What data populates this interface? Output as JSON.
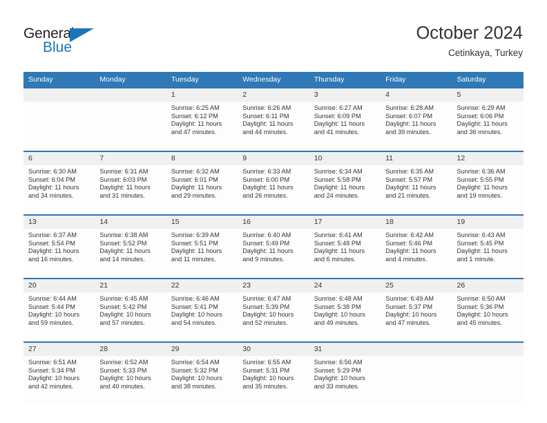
{
  "brand": {
    "name_top": "General",
    "name_bottom": "Blue",
    "triangle_icon": "blue-triangle-icon",
    "color_dark": "#231f20",
    "color_blue": "#1b75bb"
  },
  "header": {
    "title": "October 2024",
    "subtitle": "Cetinkaya, Turkey"
  },
  "theme": {
    "header_blue": "#3078b6",
    "row_divider_blue": "#2e75b6",
    "daynum_band": "#f0f0f0",
    "text": "#333333"
  },
  "calendar": {
    "weekday_headers": [
      "Sunday",
      "Monday",
      "Tuesday",
      "Wednesday",
      "Thursday",
      "Friday",
      "Saturday"
    ],
    "weeks": [
      [
        {
          "day": "",
          "lines": []
        },
        {
          "day": "",
          "lines": []
        },
        {
          "day": "1",
          "lines": [
            "Sunrise: 6:25 AM",
            "Sunset: 6:12 PM",
            "Daylight: 11 hours",
            "and 47 minutes."
          ]
        },
        {
          "day": "2",
          "lines": [
            "Sunrise: 6:26 AM",
            "Sunset: 6:11 PM",
            "Daylight: 11 hours",
            "and 44 minutes."
          ]
        },
        {
          "day": "3",
          "lines": [
            "Sunrise: 6:27 AM",
            "Sunset: 6:09 PM",
            "Daylight: 11 hours",
            "and 41 minutes."
          ]
        },
        {
          "day": "4",
          "lines": [
            "Sunrise: 6:28 AM",
            "Sunset: 6:07 PM",
            "Daylight: 11 hours",
            "and 39 minutes."
          ]
        },
        {
          "day": "5",
          "lines": [
            "Sunrise: 6:29 AM",
            "Sunset: 6:06 PM",
            "Daylight: 11 hours",
            "and 36 minutes."
          ]
        }
      ],
      [
        {
          "day": "6",
          "lines": [
            "Sunrise: 6:30 AM",
            "Sunset: 6:04 PM",
            "Daylight: 11 hours",
            "and 34 minutes."
          ]
        },
        {
          "day": "7",
          "lines": [
            "Sunrise: 6:31 AM",
            "Sunset: 6:03 PM",
            "Daylight: 11 hours",
            "and 31 minutes."
          ]
        },
        {
          "day": "8",
          "lines": [
            "Sunrise: 6:32 AM",
            "Sunset: 6:01 PM",
            "Daylight: 11 hours",
            "and 29 minutes."
          ]
        },
        {
          "day": "9",
          "lines": [
            "Sunrise: 6:33 AM",
            "Sunset: 6:00 PM",
            "Daylight: 11 hours",
            "and 26 minutes."
          ]
        },
        {
          "day": "10",
          "lines": [
            "Sunrise: 6:34 AM",
            "Sunset: 5:58 PM",
            "Daylight: 11 hours",
            "and 24 minutes."
          ]
        },
        {
          "day": "11",
          "lines": [
            "Sunrise: 6:35 AM",
            "Sunset: 5:57 PM",
            "Daylight: 11 hours",
            "and 21 minutes."
          ]
        },
        {
          "day": "12",
          "lines": [
            "Sunrise: 6:36 AM",
            "Sunset: 5:55 PM",
            "Daylight: 11 hours",
            "and 19 minutes."
          ]
        }
      ],
      [
        {
          "day": "13",
          "lines": [
            "Sunrise: 6:37 AM",
            "Sunset: 5:54 PM",
            "Daylight: 11 hours",
            "and 16 minutes."
          ]
        },
        {
          "day": "14",
          "lines": [
            "Sunrise: 6:38 AM",
            "Sunset: 5:52 PM",
            "Daylight: 11 hours",
            "and 14 minutes."
          ]
        },
        {
          "day": "15",
          "lines": [
            "Sunrise: 6:39 AM",
            "Sunset: 5:51 PM",
            "Daylight: 11 hours",
            "and 11 minutes."
          ]
        },
        {
          "day": "16",
          "lines": [
            "Sunrise: 6:40 AM",
            "Sunset: 5:49 PM",
            "Daylight: 11 hours",
            "and 9 minutes."
          ]
        },
        {
          "day": "17",
          "lines": [
            "Sunrise: 6:41 AM",
            "Sunset: 5:48 PM",
            "Daylight: 11 hours",
            "and 6 minutes."
          ]
        },
        {
          "day": "18",
          "lines": [
            "Sunrise: 6:42 AM",
            "Sunset: 5:46 PM",
            "Daylight: 11 hours",
            "and 4 minutes."
          ]
        },
        {
          "day": "19",
          "lines": [
            "Sunrise: 6:43 AM",
            "Sunset: 5:45 PM",
            "Daylight: 11 hours",
            "and 1 minute."
          ]
        }
      ],
      [
        {
          "day": "20",
          "lines": [
            "Sunrise: 6:44 AM",
            "Sunset: 5:44 PM",
            "Daylight: 10 hours",
            "and 59 minutes."
          ]
        },
        {
          "day": "21",
          "lines": [
            "Sunrise: 6:45 AM",
            "Sunset: 5:42 PM",
            "Daylight: 10 hours",
            "and 57 minutes."
          ]
        },
        {
          "day": "22",
          "lines": [
            "Sunrise: 6:46 AM",
            "Sunset: 5:41 PM",
            "Daylight: 10 hours",
            "and 54 minutes."
          ]
        },
        {
          "day": "23",
          "lines": [
            "Sunrise: 6:47 AM",
            "Sunset: 5:39 PM",
            "Daylight: 10 hours",
            "and 52 minutes."
          ]
        },
        {
          "day": "24",
          "lines": [
            "Sunrise: 6:48 AM",
            "Sunset: 5:38 PM",
            "Daylight: 10 hours",
            "and 49 minutes."
          ]
        },
        {
          "day": "25",
          "lines": [
            "Sunrise: 6:49 AM",
            "Sunset: 5:37 PM",
            "Daylight: 10 hours",
            "and 47 minutes."
          ]
        },
        {
          "day": "26",
          "lines": [
            "Sunrise: 6:50 AM",
            "Sunset: 5:36 PM",
            "Daylight: 10 hours",
            "and 45 minutes."
          ]
        }
      ],
      [
        {
          "day": "27",
          "lines": [
            "Sunrise: 6:51 AM",
            "Sunset: 5:34 PM",
            "Daylight: 10 hours",
            "and 42 minutes."
          ]
        },
        {
          "day": "28",
          "lines": [
            "Sunrise: 6:52 AM",
            "Sunset: 5:33 PM",
            "Daylight: 10 hours",
            "and 40 minutes."
          ]
        },
        {
          "day": "29",
          "lines": [
            "Sunrise: 6:54 AM",
            "Sunset: 5:32 PM",
            "Daylight: 10 hours",
            "and 38 minutes."
          ]
        },
        {
          "day": "30",
          "lines": [
            "Sunrise: 6:55 AM",
            "Sunset: 5:31 PM",
            "Daylight: 10 hours",
            "and 35 minutes."
          ]
        },
        {
          "day": "31",
          "lines": [
            "Sunrise: 6:56 AM",
            "Sunset: 5:29 PM",
            "Daylight: 10 hours",
            "and 33 minutes."
          ]
        },
        {
          "day": "",
          "lines": []
        },
        {
          "day": "",
          "lines": []
        }
      ]
    ]
  }
}
